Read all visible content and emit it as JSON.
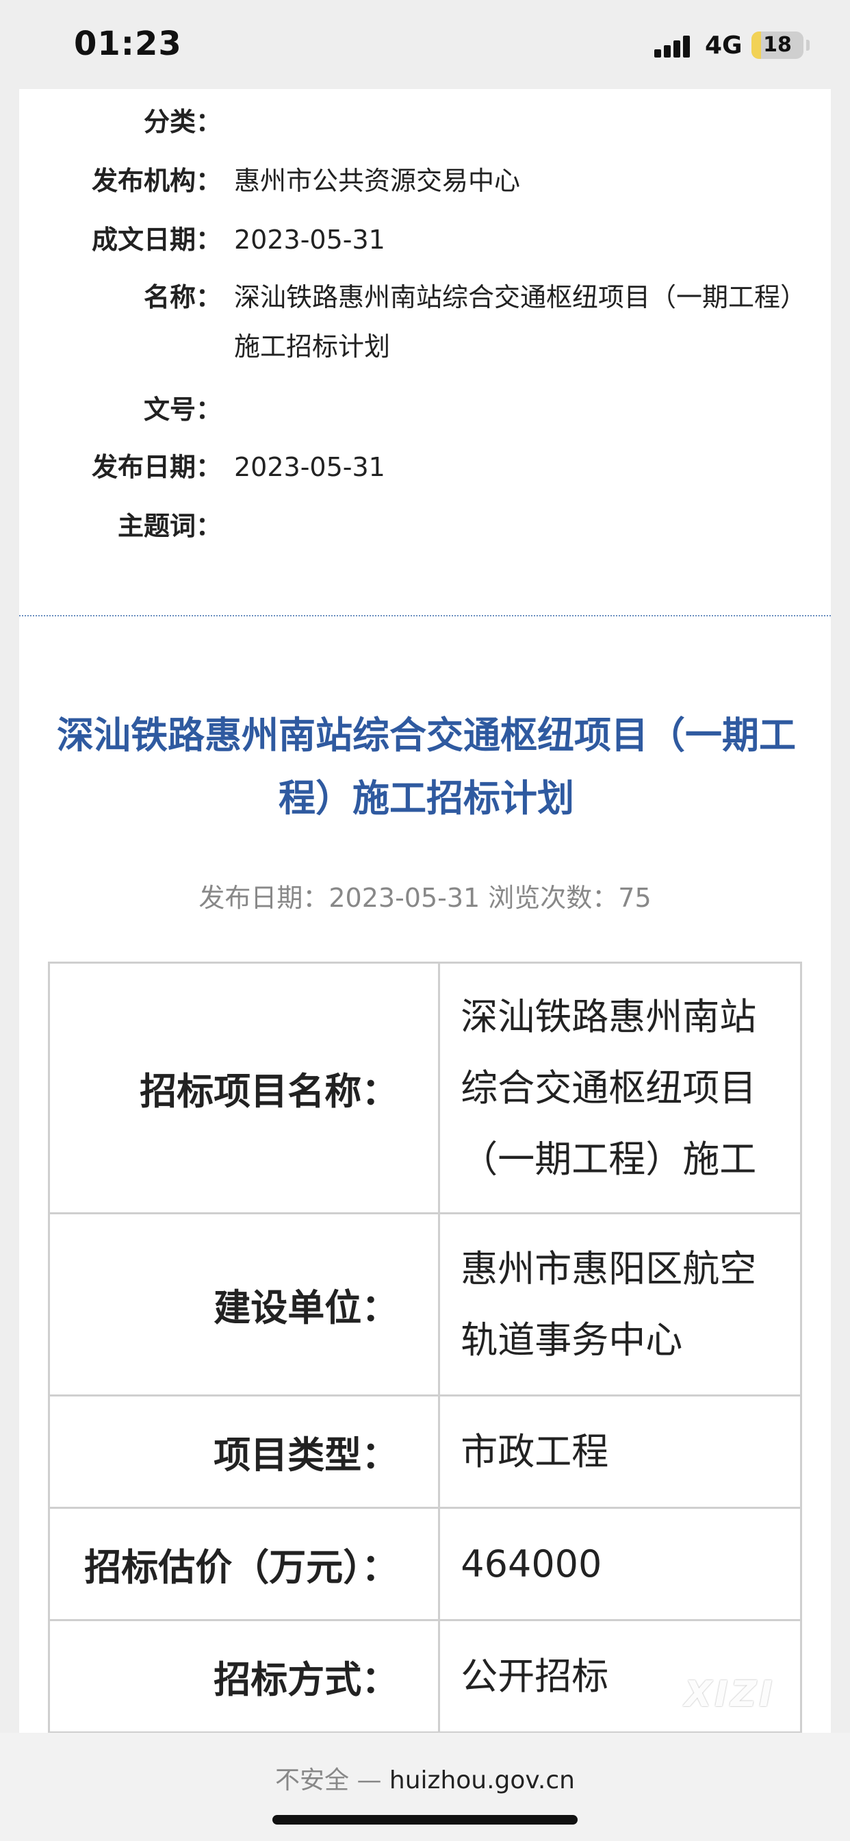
{
  "status_bar": {
    "time": "01:23",
    "network": "4G",
    "battery_level": "18",
    "battery_fraction": 0.18
  },
  "meta": {
    "rows": [
      {
        "label": "分类：",
        "value": ""
      },
      {
        "label": "发布机构：",
        "value": "惠州市公共资源交易中心"
      },
      {
        "label": "成文日期：",
        "value": "2023-05-31"
      },
      {
        "label": "名称：",
        "value": "深汕铁路惠州南站综合交通枢纽项目（一期工程）施工招标计划"
      },
      {
        "label": "文号：",
        "value": ""
      },
      {
        "label": "发布日期：",
        "value": "2023-05-31"
      },
      {
        "label": "主题词：",
        "value": ""
      }
    ]
  },
  "article": {
    "title": "深汕铁路惠州南站综合交通枢纽项目（一期工程）施工招标计划",
    "publish_info": "发布日期：2023-05-31  浏览次数：75"
  },
  "table": {
    "rows": [
      {
        "key": "招标项目名称：",
        "value": "深汕铁路惠州南站综合交通枢纽项目（一期工程）施工"
      },
      {
        "key": "建设单位：",
        "value": "惠州市惠阳区航空轨道事务中心"
      },
      {
        "key": "项目类型：",
        "value": "市政工程"
      },
      {
        "key": "招标估价（万元）：",
        "value": "464000"
      },
      {
        "key": "招标方式：",
        "value": "公开招标"
      }
    ]
  },
  "watermark": "XIZI",
  "browser": {
    "insecure_label": "不安全 —",
    "domain": "huizhou.gov.cn"
  },
  "colors": {
    "title_blue": "#2f5aa0",
    "battery_yellow": "#f2d256"
  },
  "icons": [
    "signal-icon",
    "battery-icon"
  ]
}
